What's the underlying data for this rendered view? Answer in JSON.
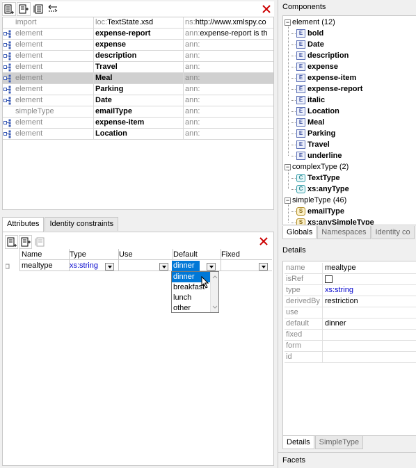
{
  "schema_grid": {
    "rows": [
      {
        "kind": "import",
        "name_prefix": "loc:",
        "name": "TextState.xsd",
        "ns_prefix": "ns:",
        "ns": "http://www.xmlspy.co",
        "has_icon": false
      },
      {
        "kind": "element",
        "name": "expense-report",
        "ns_prefix": "ann:",
        "ns": "expense-report is th",
        "has_icon": true
      },
      {
        "kind": "element",
        "name": "expense",
        "ns_prefix": "ann:",
        "ns": "",
        "has_icon": true
      },
      {
        "kind": "element",
        "name": "description",
        "ns_prefix": "ann:",
        "ns": "",
        "has_icon": true
      },
      {
        "kind": "element",
        "name": "Travel",
        "ns_prefix": "ann:",
        "ns": "",
        "has_icon": true
      },
      {
        "kind": "element",
        "name": "Meal",
        "ns_prefix": "ann:",
        "ns": "",
        "has_icon": true,
        "selected": true
      },
      {
        "kind": "element",
        "name": "Parking",
        "ns_prefix": "ann:",
        "ns": "",
        "has_icon": true
      },
      {
        "kind": "element",
        "name": "Date",
        "ns_prefix": "ann:",
        "ns": "",
        "has_icon": true
      },
      {
        "kind": "simpleType",
        "name": "emailType",
        "ns_prefix": "ann:",
        "ns": "",
        "has_icon": false
      },
      {
        "kind": "element",
        "name": "expense-item",
        "ns_prefix": "ann:",
        "ns": "",
        "has_icon": true
      },
      {
        "kind": "element",
        "name": "Location",
        "ns_prefix": "ann:",
        "ns": "",
        "has_icon": true
      }
    ]
  },
  "attr_tabs": [
    "Attributes",
    "Identity constraints"
  ],
  "attributes": {
    "headers": {
      "name": "Name",
      "type": "Type",
      "use": "Use",
      "default": "Default",
      "fixed": "Fixed"
    },
    "row": {
      "name": "mealtype",
      "type": "xs:string",
      "use": "",
      "default": "dinner",
      "fixed": ""
    },
    "default_options": [
      "dinner",
      "breakfast",
      "lunch",
      "other"
    ],
    "highlighted_option": "dinner"
  },
  "components": {
    "title": "Components",
    "groups": [
      {
        "label": "element",
        "count": "(12)",
        "icon": "E",
        "items": [
          "bold",
          "Date",
          "description",
          "expense",
          "expense-item",
          "expense-report",
          "italic",
          "Location",
          "Meal",
          "Parking",
          "Travel",
          "underline"
        ]
      },
      {
        "label": "complexType",
        "count": "(2)",
        "icon": "C",
        "items": [
          "TextType",
          "xs:anyType"
        ]
      },
      {
        "label": "simpleType",
        "count": "(46)",
        "icon": "S",
        "items": [
          "emailType",
          "xs:anySimpleType"
        ]
      }
    ],
    "tabs": [
      "Globals",
      "Namespaces",
      "Identity co"
    ]
  },
  "details": {
    "title": "Details",
    "rows": [
      {
        "key": "name",
        "value": "mealtype",
        "style": "plain"
      },
      {
        "key": "isRef",
        "value": "",
        "style": "checkbox"
      },
      {
        "key": "type",
        "value": "xs:string",
        "style": "blue"
      },
      {
        "key": "derivedBy",
        "value": "restriction",
        "style": "plain"
      },
      {
        "key": "use",
        "value": "",
        "style": "plain"
      },
      {
        "key": "default",
        "value": "dinner",
        "style": "plain"
      },
      {
        "key": "fixed",
        "value": "",
        "style": "plain"
      },
      {
        "key": "form",
        "value": "",
        "style": "plain"
      },
      {
        "key": "id",
        "value": "",
        "style": "plain"
      }
    ],
    "tabs": [
      "Details",
      "SimpleType"
    ]
  },
  "facets": {
    "title": "Facets"
  },
  "colors": {
    "accent": "#0078d7",
    "close_red": "#cc0000",
    "blue_text": "#0000cc"
  }
}
